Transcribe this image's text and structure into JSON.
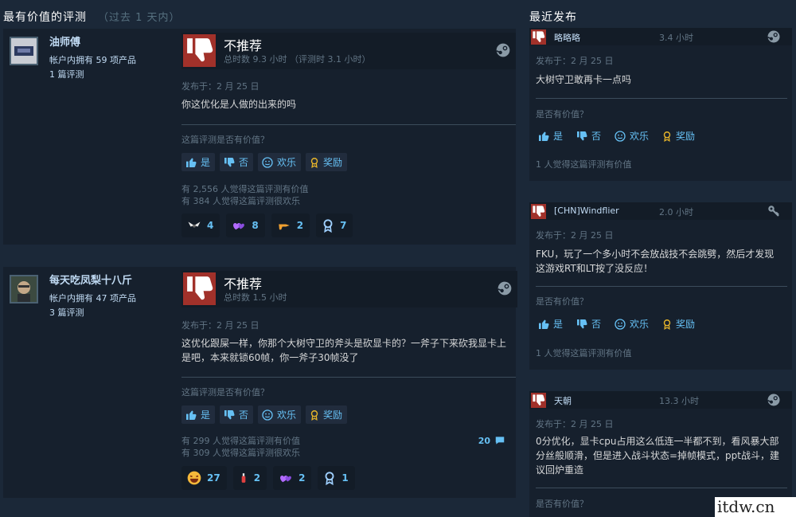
{
  "headers": {
    "most_helpful": "最有价值的评测",
    "most_helpful_sub": "（过去 1 天内）",
    "recent": "最近发布"
  },
  "reviews": [
    {
      "author": "油师傅",
      "products": "帐户内拥有 59 项产品",
      "review_count": "1 篇评测",
      "verdict": "不推荐",
      "hours": "总时数 9.3 小时  （评测时 3.1 小时）",
      "posted": "发布于：2 月 25 日",
      "text": "你这优化是人做的出来的吗",
      "helpful_question": "这篇评测是否有价值？",
      "votes": {
        "yes": "是",
        "no": "否",
        "funny": "欢乐",
        "award": "奖励"
      },
      "stat_helpful": "有 2,556 人觉得这篇评测有价值",
      "stat_funny": "有 384 人觉得这篇评测很欢乐",
      "awards": [
        "4",
        "8",
        "2",
        "7"
      ]
    },
    {
      "author": "每天吃凤梨十八斤",
      "products": "帐户内拥有 47 项产品",
      "review_count": "3 篇评测",
      "verdict": "不推荐",
      "hours": "总时数 1.5 小时",
      "posted": "发布于：2 月 25 日",
      "text": "这优化跟屎一样，你那个大树守卫的斧头是砍显卡的？一斧子下来砍我显卡上是吧，本来就锁60帧，你一斧子30帧没了",
      "helpful_question": "这篇评测是否有价值？",
      "votes": {
        "yes": "是",
        "no": "否",
        "funny": "欢乐",
        "award": "奖励"
      },
      "stat_helpful": "有 299 人觉得这篇评测有价值",
      "stat_funny": "有 309 人觉得这篇评测很欢乐",
      "comments": "20",
      "awards": [
        "27",
        "2",
        "2",
        "1"
      ]
    }
  ],
  "recent": [
    {
      "name": "略略略",
      "hours": "3.4 小时",
      "posted": "发布于：2 月 25 日",
      "text": "大树守卫敢再卡一点吗",
      "helpful_question": "是否有价值？",
      "votes": {
        "yes": "是",
        "no": "否",
        "funny": "欢乐",
        "award": "奖励"
      },
      "stat": "1 人觉得这篇评测有价值"
    },
    {
      "name": "[CHN]Windflier",
      "hours": "2.0 小时",
      "posted": "发布于：2 月 25 日",
      "text": "FKU，玩了一个多小时不会放战技不会跳劈，然后才发现这游戏RT和LT按了没反应！",
      "helpful_question": "是否有价值？",
      "votes": {
        "yes": "是",
        "no": "否",
        "funny": "欢乐",
        "award": "奖励"
      },
      "stat": "1 人觉得这篇评测有价值"
    },
    {
      "name": "天朝",
      "hours": "13.3 小时",
      "posted": "发布于：2 月 25 日",
      "text": "0分优化，显卡cpu占用这么低连一半都不到，看风暴大部分丝般顺滑，但是进入战斗状态=掉帧模式，ppt战斗，建议回炉重造",
      "helpful_question": "是否有价值？"
    }
  ],
  "watermark": "itdw.cn",
  "colors": {
    "background": "#1b2838",
    "thumb_down": "#a1312a",
    "link": "#66c0f4",
    "award_gold": "#e6b42a"
  }
}
